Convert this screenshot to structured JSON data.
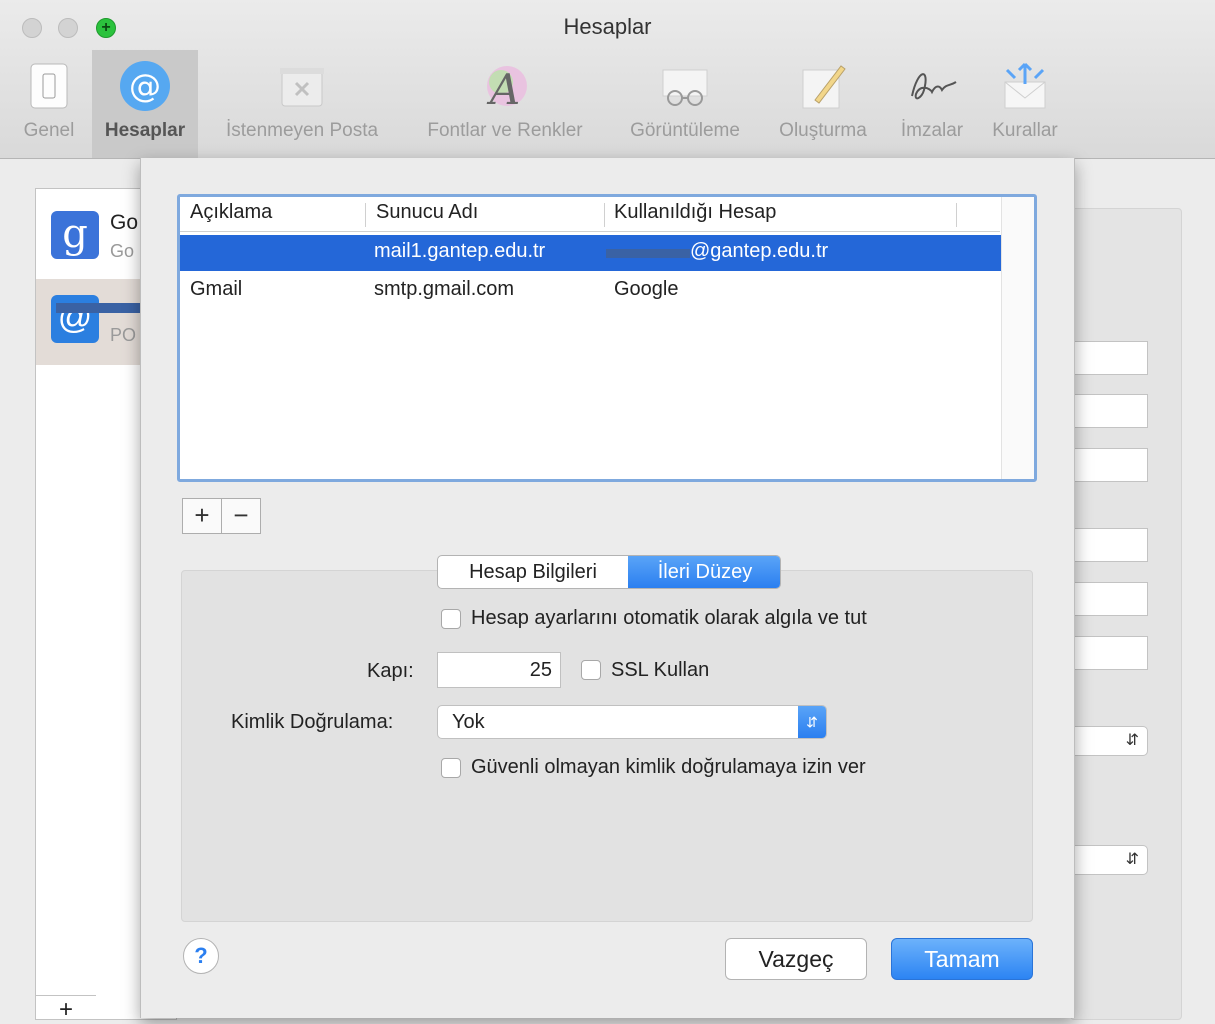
{
  "window": {
    "title": "Hesaplar"
  },
  "toolbar": {
    "items": [
      {
        "label": "Genel",
        "icon": "general-switch-icon"
      },
      {
        "label": "Hesaplar",
        "icon": "at-sign-icon"
      },
      {
        "label": "İstenmeyen Posta",
        "icon": "junk-trash-icon"
      },
      {
        "label": "Fontlar ve Renkler",
        "icon": "font-color-icon"
      },
      {
        "label": "Görüntüleme",
        "icon": "glasses-icon"
      },
      {
        "label": "Oluşturma",
        "icon": "pencil-icon"
      },
      {
        "label": "İmzalar",
        "icon": "signature-icon"
      },
      {
        "label": "Kurallar",
        "icon": "rules-envelope-icon"
      }
    ],
    "selected": "Hesaplar"
  },
  "accounts": [
    {
      "name": "Go",
      "sub": "Go",
      "icon": "google-icon"
    },
    {
      "name": "",
      "sub": "PO",
      "icon": "mail-at-icon"
    }
  ],
  "sheet": {
    "table": {
      "columns": [
        "Açıklama",
        "Sunucu Adı",
        "Kullanıldığı Hesap"
      ],
      "rows": [
        {
          "description": "",
          "server": "mail1.gantep.edu.tr",
          "account": "@gantep.edu.tr",
          "selected": true
        },
        {
          "description": "Gmail",
          "server": "smtp.gmail.com",
          "account": "Google",
          "selected": false
        }
      ]
    },
    "add_label": "+",
    "remove_label": "−",
    "tabs": [
      {
        "label": "Hesap Bilgileri",
        "active": false
      },
      {
        "label": "İleri Düzey",
        "active": true
      }
    ],
    "auto_detect_label": "Hesap ayarlarını otomatik olarak algıla ve tut",
    "auto_detect_checked": false,
    "port_label": "Kapı:",
    "port_value": "25",
    "ssl_label": "SSL Kullan",
    "ssl_checked": false,
    "auth_label": "Kimlik Doğrulama:",
    "auth_value": "Yok",
    "insecure_label": "Güvenli olmayan kimlik doğrulamaya izin ver",
    "insecure_checked": false,
    "help_label": "?",
    "cancel_label": "Vazgeç",
    "ok_label": "Tamam"
  },
  "colors": {
    "selection": "#2467d8",
    "accent": "#2b7ff0",
    "redaction": "#3a62a4"
  }
}
